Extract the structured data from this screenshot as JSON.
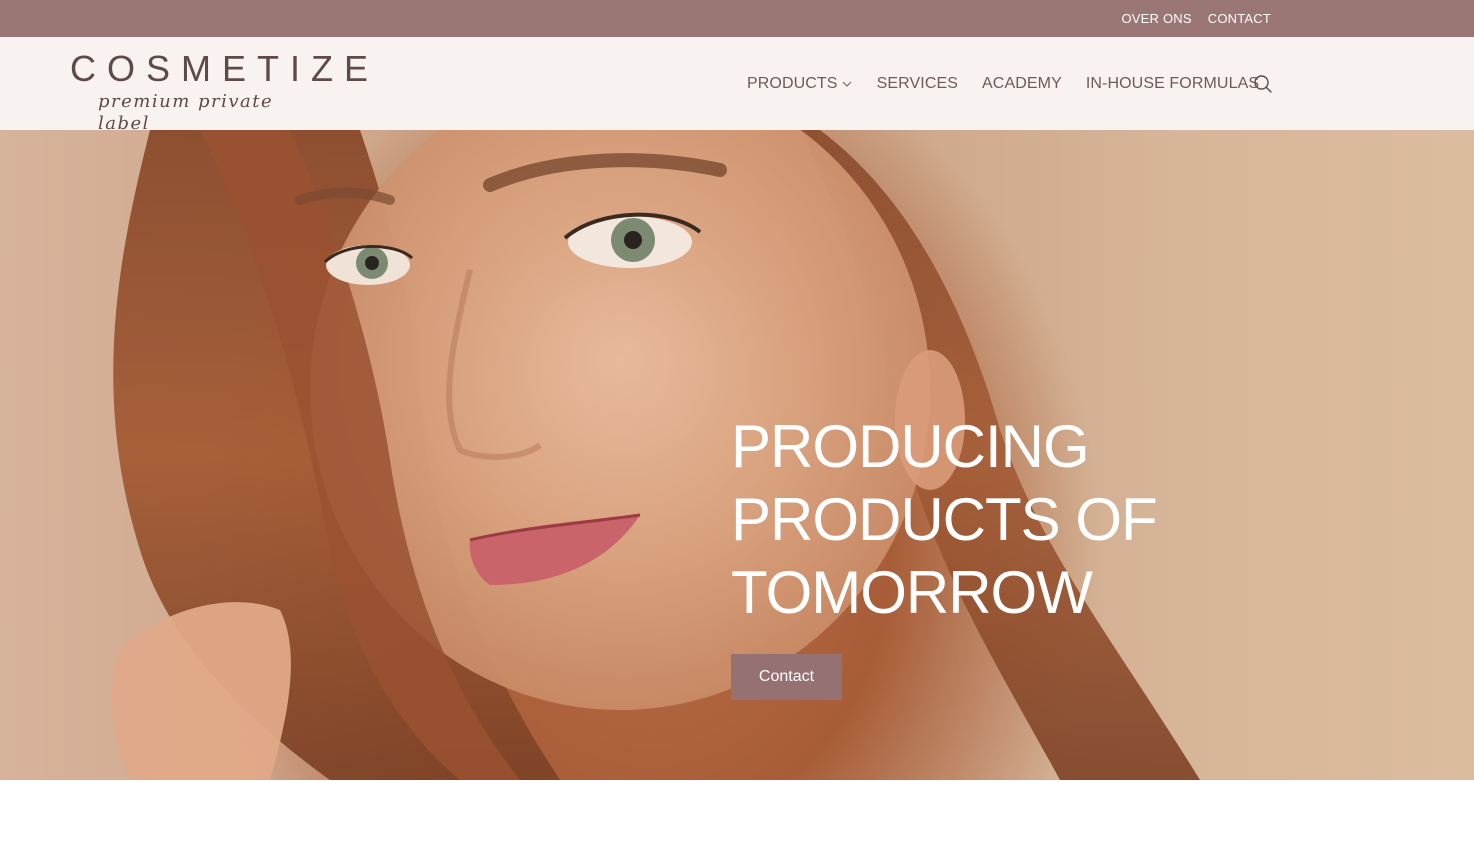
{
  "topbar": {
    "links": [
      "OVER ONS",
      "CONTACT"
    ]
  },
  "logo": {
    "wordmark": "COSMETIZE",
    "tagline": "premium private label"
  },
  "nav": {
    "items": [
      {
        "label": "PRODUCTS",
        "has_dropdown": true
      },
      {
        "label": "SERVICES",
        "has_dropdown": false
      },
      {
        "label": "ACADEMY",
        "has_dropdown": false
      },
      {
        "label": "IN-HOUSE FORMULAS",
        "has_dropdown": false
      }
    ],
    "search_icon": "search-icon"
  },
  "hero": {
    "title_lines": [
      "PRODUCING",
      "PRODUCTS OF",
      "TOMORROW"
    ],
    "cta_label": "Contact"
  },
  "colors": {
    "topbar": "#9a7675",
    "header_bg": "#f8f3f1",
    "brand_text": "#5e4a48",
    "nav_text": "#6e5a58",
    "cta_bg": "#957171"
  }
}
